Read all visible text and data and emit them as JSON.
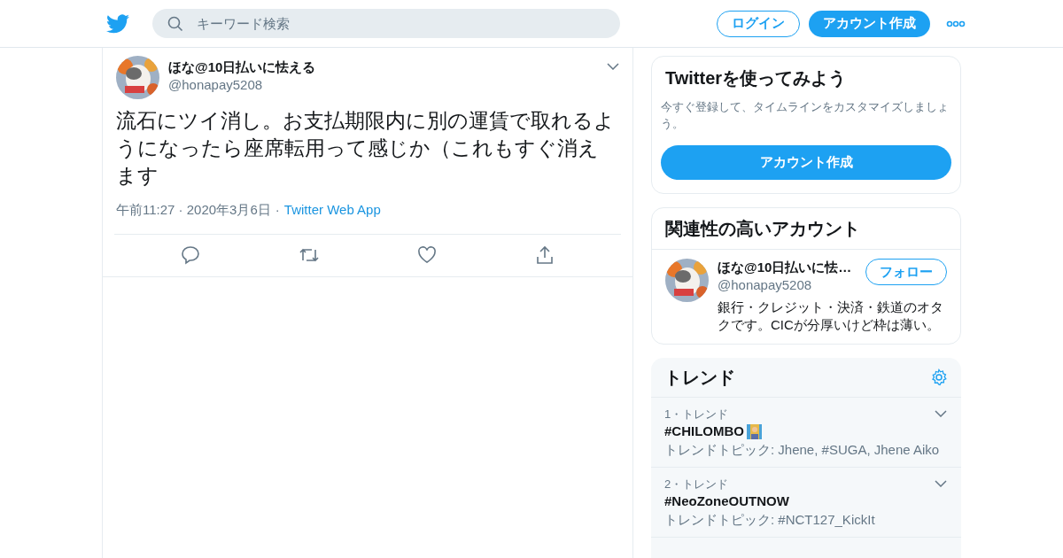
{
  "header": {
    "search": {
      "placeholder": "キーワード検索"
    },
    "login": "ログイン",
    "signup": "アカウント作成"
  },
  "tweet": {
    "name": "ほな@10日払いに怯える",
    "handle": "@honapay5208",
    "text": "流石にツイ消し。お支払期限内に別の運賃で取れるようになったら座席転用って感じか（これもすぐ消えます",
    "time": "午前11:27 · 2020年3月6日",
    "separator": "·",
    "source": "Twitter Web App"
  },
  "signup_card": {
    "title": "Twitterを使ってみよう",
    "text": "今すぐ登録して、タイムラインをカスタマイズしましょう。",
    "button": "アカウント作成"
  },
  "related": {
    "title": "関連性の高いアカウント",
    "accounts": [
      {
        "name": "ほな@10日払いに怯…",
        "handle": "@honapay5208",
        "bio": "銀行・クレジット・決済・鉄道のオタクです。CICが分厚いけど枠は薄い。",
        "follow": "フォロー"
      }
    ]
  },
  "trends": {
    "title": "トレンド",
    "items": [
      {
        "rank": "1・トレンド",
        "tag": "#CHILOMBO",
        "emoji": true,
        "topic": "トレンドトピック: Jhene, #SUGA, Jhene Aiko"
      },
      {
        "rank": "2・トレンド",
        "tag": "#NeoZoneOUTNOW",
        "emoji": false,
        "topic": "トレンドトピック: #NCT127_KickIt"
      }
    ]
  }
}
